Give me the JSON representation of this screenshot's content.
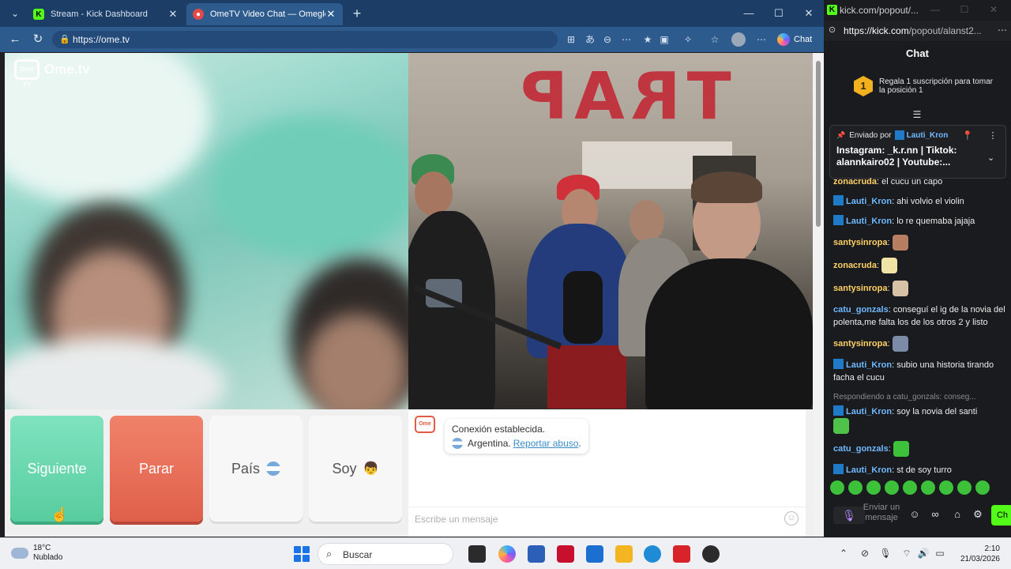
{
  "browser": {
    "tabs": [
      {
        "title": "Stream - Kick Dashboard",
        "active": false,
        "favicon": "kick-icon"
      },
      {
        "title": "OmeTV Video Chat — Omegle",
        "active": true,
        "favicon": "record-icon"
      }
    ],
    "url": "https://ome.tv",
    "copilot_label": "Chat"
  },
  "page": {
    "logo_text": "Ome.tv",
    "logo_badge": "Ome TV",
    "buttons": {
      "next": "Siguiente",
      "stop": "Parar",
      "country": "País",
      "gender": "Soy"
    },
    "system_message": {
      "line1": "Conexión establecida.",
      "country": "Argentina.",
      "report_link": "Reportar abuso",
      "line2_end": "."
    },
    "message_placeholder": "Escribe un mensaje",
    "video_text": "TRAP"
  },
  "kick": {
    "window_title": "kick.com/popout/...",
    "url_host": "https://kick.com",
    "url_path": "/popout/alanst2...",
    "chat_title": "Chat",
    "sub_goal": {
      "rank": "1",
      "text": "Regala 1 suscripción para tomar la posición 1"
    },
    "pinned": {
      "label": "Enviado por",
      "user": "Lauti_Kron",
      "text": "Instagram: _k.r.nn | Tiktok: alannkairo02 | Youtube:..."
    },
    "messages": [
      {
        "user": "zonacruda",
        "text": "el cucu un capo",
        "color": "#ffd166",
        "badge": false,
        "emote": ""
      },
      {
        "user": "Lauti_Kron",
        "text": "ahi volvio el violin",
        "color": "#6fb9ff",
        "badge": true,
        "emote": ""
      },
      {
        "user": "Lauti_Kron",
        "text": "lo re quemaba jajaja",
        "color": "#6fb9ff",
        "badge": true,
        "emote": ""
      },
      {
        "user": "santysinropa",
        "text": "",
        "color": "#ffd166",
        "badge": false,
        "emote": "#b77e62"
      },
      {
        "user": "zonacruda",
        "text": "",
        "color": "#ffd166",
        "badge": false,
        "emote": "#f1e3a6"
      },
      {
        "user": "santysinropa",
        "text": "",
        "color": "#ffd166",
        "badge": false,
        "emote": "#d8c2a6"
      },
      {
        "user": "catu_gonzals",
        "text": "conseguí el ig de la novia del polenta,me falta los de los otros 2 y listo",
        "color": "#6fb9ff",
        "badge": false,
        "emote": ""
      },
      {
        "user": "santysinropa",
        "text": "",
        "color": "#ffd166",
        "badge": false,
        "emote": "#7a8ca8"
      },
      {
        "user": "Lauti_Kron",
        "text": "subio una historia tirando facha el cucu",
        "color": "#6fb9ff",
        "badge": true,
        "emote": ""
      },
      {
        "reply": "Respondiendo a catu_gonzals: conseg..."
      },
      {
        "user": "Lauti_Kron",
        "text": "soy la novia del santi",
        "color": "#6fb9ff",
        "badge": true,
        "emote": "#4fc24a"
      },
      {
        "user": "catu_gonzals",
        "text": "",
        "color": "#6fb9ff",
        "badge": false,
        "emote": "#3dc13a"
      },
      {
        "user": "Lauti_Kron",
        "text": "st de soy turro",
        "color": "#6fb9ff",
        "badge": true,
        "emote": ""
      }
    ],
    "input_placeholder": "Enviar un mensaje",
    "send_label": "Ch"
  },
  "taskbar": {
    "weather_temp": "18°C",
    "weather_desc": "Nublado",
    "search_label": "Buscar",
    "time": "2:10",
    "date": "21/03/2026"
  }
}
